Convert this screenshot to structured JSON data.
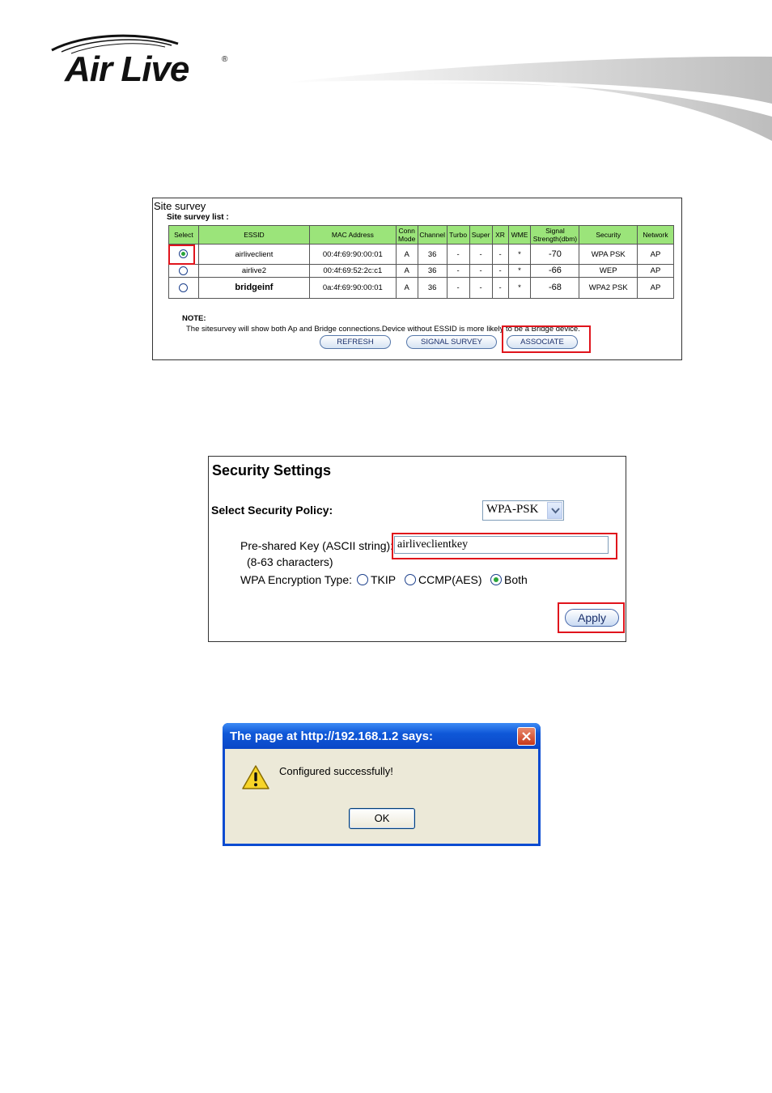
{
  "brand": {
    "logo_text": "Air Live",
    "registered": "®"
  },
  "site_survey": {
    "title": "Site survey",
    "subtitle": "Site survey list :",
    "columns": [
      "Select",
      "ESSID",
      "MAC Address",
      "Conn Mode",
      "Channel",
      "Turbo",
      "Super",
      "XR",
      "WME",
      "Signal Strength(dbm)",
      "Security",
      "Network"
    ],
    "rows": [
      {
        "selected": true,
        "essid": "airliveclient",
        "mac": "00:4f:69:90:00:01",
        "conn": "A",
        "channel": "36",
        "turbo": "-",
        "super": "-",
        "xr": "-",
        "wme": "*",
        "signal": "-70",
        "security": "WPA PSK",
        "network": "AP"
      },
      {
        "selected": false,
        "essid": "airlive2",
        "mac": "00:4f:69:52:2c:c1",
        "conn": "A",
        "channel": "36",
        "turbo": "-",
        "super": "-",
        "xr": "-",
        "wme": "*",
        "signal": "-66",
        "security": "WEP",
        "network": "AP"
      },
      {
        "selected": false,
        "essid": "bridgeinf",
        "mac": "0a:4f:69:90:00:01",
        "conn": "A",
        "channel": "36",
        "turbo": "-",
        "super": "-",
        "xr": "-",
        "wme": "*",
        "signal": "-68",
        "security": "WPA2 PSK",
        "network": "AP"
      }
    ],
    "note_label": "NOTE:",
    "note_text": "The sitesurvey will show both Ap and Bridge connections.Device without ESSID is more likely to be a Bridge device.",
    "buttons": {
      "refresh": "REFRESH",
      "signal_survey": "SIGNAL SURVEY",
      "associate": "ASSOCIATE"
    }
  },
  "security_settings": {
    "title": "Security Settings",
    "policy_label": "Select Security Policy:",
    "policy_value": "WPA-PSK",
    "psk_label": "Pre-shared Key (ASCII string):",
    "psk_hint": "(8-63 characters)",
    "psk_value": "airliveclientkey",
    "encryption_label": "WPA Encryption Type:",
    "encryption_options": [
      {
        "label": "TKIP",
        "selected": false
      },
      {
        "label": "CCMP(AES)",
        "selected": false
      },
      {
        "label": "Both",
        "selected": true
      }
    ],
    "apply_label": "Apply"
  },
  "dialog": {
    "title": "The page at http://192.168.1.2 says:",
    "message": "Configured successfully!",
    "ok_label": "OK",
    "icon": "warning-icon"
  },
  "colors": {
    "table_header": "#9be47a",
    "highlight": "#e0141c",
    "dialog_titlebar": "#0a4bd1"
  }
}
